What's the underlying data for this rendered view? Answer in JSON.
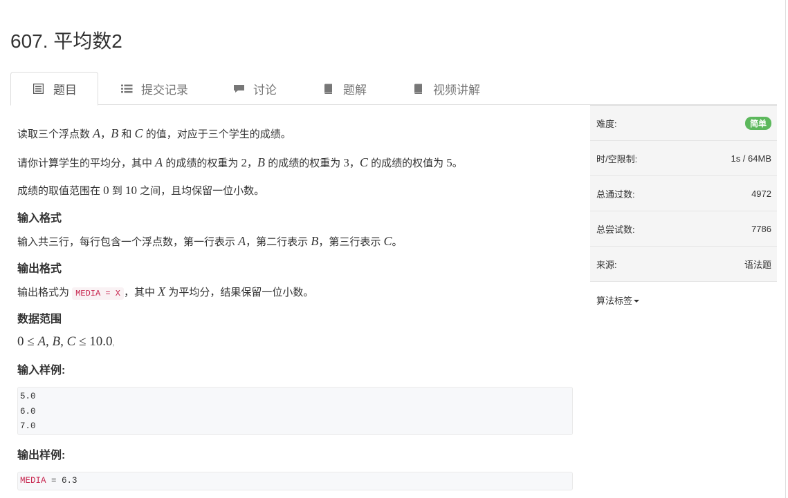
{
  "problem": {
    "title": "607. 平均数2"
  },
  "tabs": [
    {
      "label": "题目",
      "icon": "list-icon"
    },
    {
      "label": "提交记录",
      "icon": "bars-icon"
    },
    {
      "label": "讨论",
      "icon": "comment-icon"
    },
    {
      "label": "题解",
      "icon": "book-icon"
    },
    {
      "label": "视频讲解",
      "icon": "book-icon"
    }
  ],
  "desc": {
    "p1": {
      "a": "读取三个浮点数 ",
      "A": "A",
      "sep1": "，",
      "B": "B",
      "and": " 和 ",
      "C": "C",
      "tail": " 的值，对应于三个学生的成绩。"
    },
    "p2": {
      "a": "请你计算学生的平均分，其中 ",
      "A": "A",
      "t1": " 的成绩的权重为 ",
      "n2": "2",
      "c1": "，",
      "B": "B",
      "t2": " 的成绩的权重为 ",
      "n3": "3",
      "c2": "，",
      "C": "C",
      "t3": " 的成绩的权值为 ",
      "n5": "5",
      "end": "。"
    },
    "p3": {
      "a": "成绩的取值范围在 ",
      "n0": "0",
      "to": " 到 ",
      "n10": "10",
      "tail": " 之间，且均保留一位小数。"
    },
    "input_title": "输入格式",
    "input_text": {
      "a": "输入共三行，每行包含一个浮点数，第一行表示 ",
      "A": "A",
      "b": "，第二行表示 ",
      "B": "B",
      "c": "，第三行表示 ",
      "C": "C",
      "end": "。"
    },
    "output_title": "输出格式",
    "output_text": {
      "a": "输出格式为 ",
      "code": "MEDIA = X",
      "b": "，其中 ",
      "X": "X",
      "c": " 为平均分，结果保留一位小数。"
    },
    "range_title": "数据范围",
    "range_formula": {
      "a": "0 ≤ ",
      "vars": "A, B, C",
      "b": " ≤ 10.0",
      "c": ","
    },
    "sample_in_title": "输入样例:",
    "sample_in": [
      "5.0",
      "6.0",
      "7.0"
    ],
    "sample_out_title": "输出样例:",
    "sample_out": {
      "kw": "MEDIA",
      "rest": " = 6.3"
    }
  },
  "sidebar": {
    "difficulty_label": "难度:",
    "difficulty_value": "简单",
    "difficulty_color": "#5cb85c",
    "limit_label": "时/空限制:",
    "limit_value": "1s / 64MB",
    "accepted_label": "总通过数:",
    "accepted_value": "4972",
    "attempts_label": "总尝试数:",
    "attempts_value": "7786",
    "source_label": "来源:",
    "source_value": "语法题",
    "tags_label": "算法标签"
  }
}
